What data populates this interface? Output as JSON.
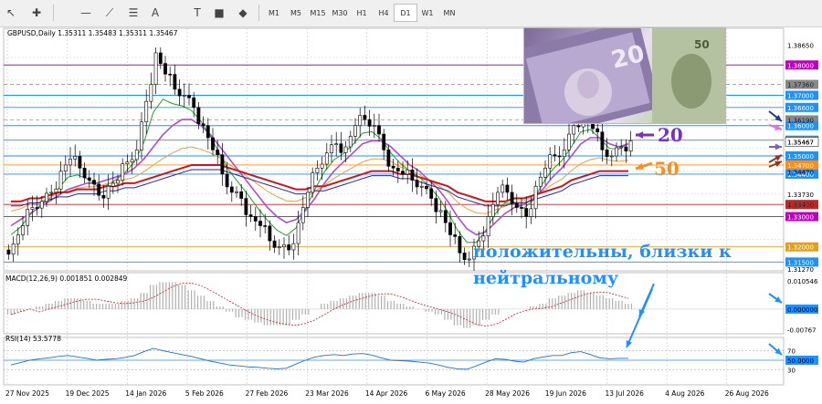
{
  "toolbar": {
    "timeframes": [
      "M1",
      "M5",
      "M15",
      "M30",
      "H1",
      "H4",
      "D1",
      "W1",
      "MN"
    ],
    "active_timeframe": "D1",
    "tools": [
      "cursor-icon",
      "crosshair-icon",
      "hline-icon",
      "trendline-icon",
      "channel-icon",
      "text-icon",
      "label-icon",
      "rectangle-icon",
      "shapes-icon"
    ]
  },
  "colors": {
    "price_line": "#a020f0",
    "label_blue": "#1e90ff",
    "arrow_navy": "#1a3f8a",
    "arrow_brown": "#8b3a1a",
    "arrow_purple": "#7a5fc8",
    "arrow_orange": "#ff8c1a",
    "arrow_pink": "#e070e0",
    "ma_red": "#d0141e",
    "ma_navy": "#1f2a9c",
    "ma_orange": "#e8a23a",
    "ma_violet": "#b04cd0",
    "ma_green": "#22a022"
  },
  "chart_data": [
    {
      "type": "candlestick",
      "title": "GBPUSD,Daily  1.35311 1.35483 1.35311 1.35467",
      "ylim": [
        1.3127,
        1.3885
      ],
      "y_ticks": [
        "1.38650",
        "1.37360",
        "1.36190",
        "1.35467",
        "1.34470",
        "1.33730",
        "1.33400",
        "1.31270"
      ],
      "levels": [
        {
          "label": "1.38000",
          "value": 1.38,
          "color": "#c000c0",
          "style": "solid"
        },
        {
          "label": "1.37360",
          "value": 1.3736,
          "color": "#888888",
          "style": "dash"
        },
        {
          "label": "1.37000",
          "value": 1.37,
          "color": "#1e90ff",
          "style": "solid"
        },
        {
          "label": "1.36600",
          "value": 1.366,
          "color": "#1e90ff",
          "style": "solid"
        },
        {
          "label": "1.36190",
          "value": 1.3619,
          "color": "#888888",
          "style": "dash"
        },
        {
          "label": "1.36000",
          "value": 1.36,
          "color": "#1e90ff",
          "style": "solid"
        },
        {
          "label": "1.35520",
          "value": 1.3552,
          "color": "#1e90ff",
          "style": "solid"
        },
        {
          "label": "1.35000",
          "value": 1.35,
          "color": "#1e90ff",
          "style": "solid"
        },
        {
          "label": "1.34700",
          "value": 1.347,
          "color": "#ff8c1a",
          "style": "solid"
        },
        {
          "label": "1.34400",
          "value": 1.344,
          "color": "#1e90ff",
          "style": "solid"
        },
        {
          "label": "1.33400",
          "value": 1.334,
          "color": "#cc2020",
          "style": "solid"
        },
        {
          "label": "1.33000",
          "value": 1.33,
          "color": "#c000c0",
          "style": "solid"
        },
        {
          "label": "1.32000",
          "value": 1.32,
          "color": "#e0a020",
          "style": "solid"
        },
        {
          "label": "1.31500",
          "value": 1.315,
          "color": "#1e90ff",
          "style": "solid"
        }
      ],
      "current_price": "1.35467",
      "x_labels": [
        "27 Nov 2025",
        "19 Dec 2025",
        "14 Jan 2026",
        "5 Feb 2026",
        "27 Feb 2026",
        "23 Mar 2026",
        "14 Apr 2026",
        "6 May 2026",
        "28 May 2026",
        "19 Jun 2026",
        "13 Jul 2026",
        "4 Aug 2026",
        "26 Aug 2026"
      ],
      "series": [
        {
          "name": "",
          "values": [
            1.321,
            1.327,
            1.333,
            1.335,
            1.338,
            1.345,
            1.349,
            1.346,
            1.342,
            1.337,
            1.34,
            1.342,
            1.348,
            1.352,
            1.368,
            1.384,
            1.377,
            1.372,
            1.37,
            1.366,
            1.36,
            1.352,
            1.344,
            1.338,
            1.336,
            1.33,
            1.327,
            1.322,
            1.32,
            1.319,
            1.328,
            1.338,
            1.346,
            1.351,
            1.354,
            1.353,
            1.36,
            1.362,
            1.36,
            1.352,
            1.346,
            1.344,
            1.342,
            1.34,
            1.336,
            1.332,
            1.324,
            1.318,
            1.316,
            1.322,
            1.33,
            1.338,
            1.338,
            1.333,
            1.33,
            1.34,
            1.346,
            1.35,
            1.352,
            1.36,
            1.364,
            1.359,
            1.352,
            1.35,
            1.353,
            1.355
          ]
        },
        {
          "name": "",
          "values": [
            1.327,
            1.329,
            1.331,
            1.333,
            1.335,
            1.337,
            1.339,
            1.34,
            1.341,
            1.341,
            1.342,
            1.343,
            1.344,
            1.346,
            1.349,
            1.353,
            1.357,
            1.36,
            1.362,
            1.362,
            1.36,
            1.357,
            1.353,
            1.349,
            1.345,
            1.341,
            1.337,
            1.333,
            1.33,
            1.328,
            1.329,
            1.332,
            1.336,
            1.341,
            1.345,
            1.348,
            1.351,
            1.354,
            1.355,
            1.355,
            1.353,
            1.35,
            1.347,
            1.345,
            1.342,
            1.339,
            1.335,
            1.33,
            1.326,
            1.324,
            1.325,
            1.328,
            1.331,
            1.333,
            1.334,
            1.336,
            1.339,
            1.343,
            1.346,
            1.35,
            1.354,
            1.356,
            1.356,
            1.354,
            1.353,
            1.354
          ]
        },
        {
          "name": "",
          "values": [
            1.335,
            1.335,
            1.336,
            1.336,
            1.337,
            1.338,
            1.338,
            1.339,
            1.339,
            1.339,
            1.34,
            1.34,
            1.341,
            1.341,
            1.342,
            1.343,
            1.344,
            1.345,
            1.346,
            1.347,
            1.347,
            1.347,
            1.347,
            1.346,
            1.345,
            1.344,
            1.343,
            1.342,
            1.341,
            1.34,
            1.339,
            1.339,
            1.34,
            1.34,
            1.341,
            1.342,
            1.343,
            1.344,
            1.345,
            1.345,
            1.345,
            1.344,
            1.344,
            1.343,
            1.342,
            1.341,
            1.34,
            1.338,
            1.337,
            1.336,
            1.335,
            1.335,
            1.335,
            1.336,
            1.336,
            1.337,
            1.338,
            1.339,
            1.34,
            1.342,
            1.343,
            1.344,
            1.345,
            1.345,
            1.345,
            1.345
          ]
        }
      ]
    },
    {
      "type": "bar",
      "title": "MACD(12,26,9) 0.001851 0.002849",
      "y_ticks": [
        "0.010546",
        "0.000000",
        "-0.00767"
      ],
      "ylim": [
        -0.0095,
        0.0125
      ],
      "values": [
        -0.002,
        -0.001,
        0.0,
        0.001,
        0.002,
        0.003,
        0.004,
        0.004,
        0.003,
        0.002,
        0.002,
        0.002,
        0.003,
        0.004,
        0.006,
        0.009,
        0.01,
        0.01,
        0.009,
        0.007,
        0.005,
        0.003,
        0.001,
        -0.001,
        -0.003,
        -0.004,
        -0.005,
        -0.006,
        -0.006,
        -0.006,
        -0.004,
        -0.002,
        0.0,
        0.002,
        0.003,
        0.004,
        0.005,
        0.006,
        0.006,
        0.005,
        0.003,
        0.002,
        0.001,
        0.0,
        -0.001,
        -0.002,
        -0.004,
        -0.006,
        -0.007,
        -0.006,
        -0.004,
        -0.002,
        0.0,
        0.0,
        0.0,
        0.001,
        0.002,
        0.004,
        0.005,
        0.006,
        0.007,
        0.006,
        0.005,
        0.004,
        0.003,
        0.002
      ]
    },
    {
      "type": "line",
      "title": "RSI(14) 53.5778",
      "y_ticks": [
        "70",
        "50.0000",
        "30"
      ],
      "ylim": [
        0,
        100
      ],
      "values": [
        40,
        45,
        50,
        53,
        55,
        58,
        60,
        57,
        54,
        50,
        52,
        53,
        56,
        60,
        68,
        75,
        70,
        66,
        62,
        58,
        53,
        48,
        44,
        40,
        38,
        36,
        35,
        33,
        32,
        33,
        42,
        50,
        57,
        60,
        62,
        60,
        63,
        64,
        61,
        55,
        50,
        49,
        48,
        46,
        44,
        40,
        35,
        32,
        31,
        38,
        46,
        53,
        52,
        48,
        46,
        53,
        57,
        60,
        60,
        66,
        68,
        62,
        55,
        53,
        54,
        54
      ]
    }
  ],
  "annotations": {
    "ma20": "20",
    "ma50": "50",
    "caption": "положительны, близки к нейтральному"
  }
}
